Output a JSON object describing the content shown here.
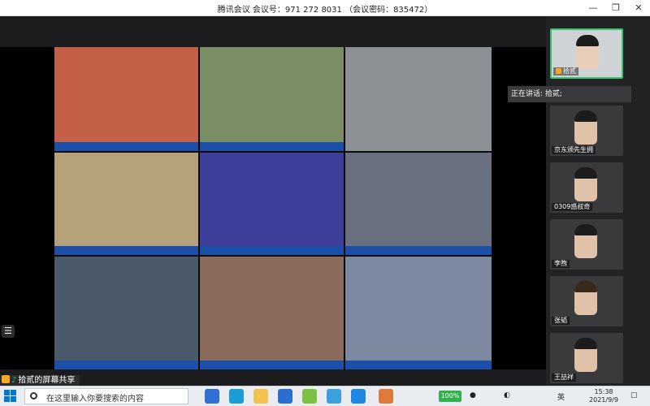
{
  "window": {
    "title": "腾讯会议 会议号：971 272 8031 （会议密码：835472）",
    "min_icon": "—",
    "restore_icon": "❐",
    "close_icon": "✕"
  },
  "share": {
    "label": "拾贰的屏幕共享",
    "speaking": "正在讲话: 拾贰;",
    "menu_icon": "☰"
  },
  "participants": [
    {
      "name": "拾贰"
    },
    {
      "name": "京东颁先生拥"
    },
    {
      "name": "0309惑叔奇"
    },
    {
      "name": "李煦"
    },
    {
      "name": "张韬"
    },
    {
      "name": "王喆祥"
    }
  ],
  "taskbar": {
    "search_placeholder": "在这里输入你要搜索的内容",
    "battery": "100%",
    "lang": "英",
    "time": "15:38",
    "date": "2021/9/9"
  },
  "colors": {
    "accent": "#36c46b",
    "brand_orange": "#f5a623",
    "ticker_blue": "#1b4fa8"
  }
}
